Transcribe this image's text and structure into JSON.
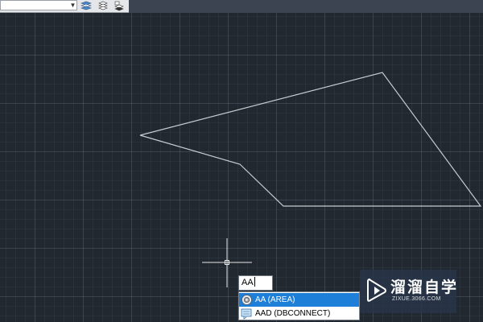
{
  "toolbar": {
    "layer_combo_value": "",
    "buttons": [
      {
        "icon": "layer-properties-icon"
      },
      {
        "icon": "layer-state-icon"
      },
      {
        "icon": "match-layer-icon"
      }
    ]
  },
  "drawing": {
    "polyline_color": "#c8ccd0",
    "crosshair_color": "#e6e8ea"
  },
  "command_line": {
    "input_value": "AA"
  },
  "autocomplete": {
    "items": [
      {
        "label": "AA (AREA)",
        "icon": "area-gear-icon",
        "selected": true
      },
      {
        "label": "AAD (DBCONNECT)",
        "icon": "dbconnect-icon",
        "selected": false
      }
    ],
    "selected_color": "#1e7fd8"
  },
  "watermark": {
    "title": "溜溜自学",
    "subtitle": "ZIXUE.3066.COM"
  }
}
